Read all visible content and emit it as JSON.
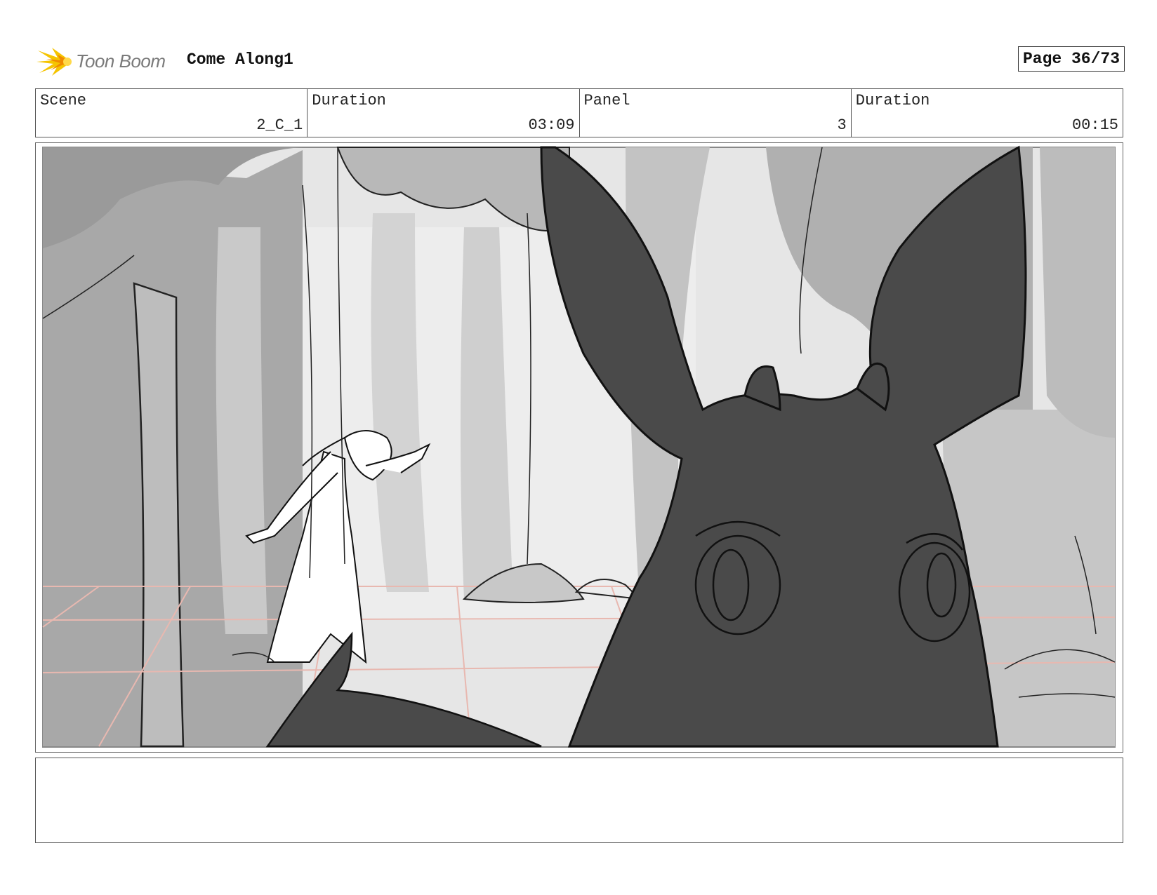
{
  "header": {
    "logo_text": "Toon Boom",
    "project_title": "Come Along1",
    "page_label": "Page 36/73"
  },
  "info": {
    "scene_label": "Scene",
    "scene_value": "2_C_1",
    "duration_label": "Duration",
    "duration_value": "03:09",
    "panel_label": "Panel",
    "panel_value": "3",
    "panel_duration_label": "Duration",
    "panel_duration_value": "00:15"
  },
  "notes": {
    "text": ""
  },
  "colors": {
    "logo_yellow": "#f5c400",
    "logo_orange": "#f08a00",
    "creature": "#4a4a4a",
    "guide_lines": "#e8b8b0"
  }
}
